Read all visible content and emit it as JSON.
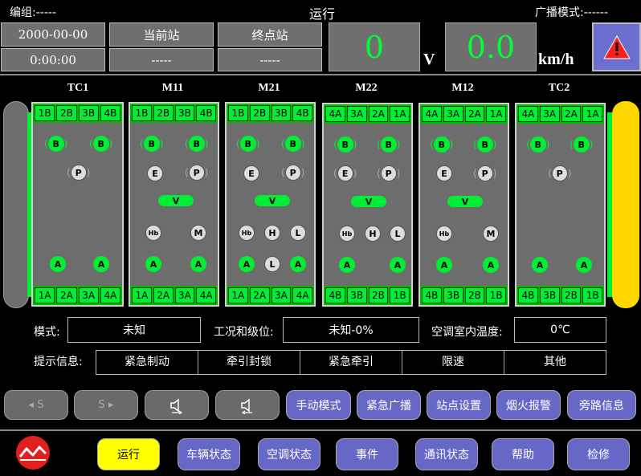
{
  "header": {
    "group_label": "编组:-----",
    "title": "运行",
    "broadcast_label": "广播模式:------"
  },
  "status": {
    "date": "2000-00-00",
    "time": "0:00:00",
    "current_station_label": "当前站",
    "current_station_value": "-----",
    "terminal_station_label": "终点站",
    "terminal_station_value": "-----",
    "voltage": "0",
    "voltage_unit": "V",
    "speed": "0.0",
    "speed_unit": "km/h"
  },
  "cars": [
    {
      "name": "TC1",
      "top": [
        "1B",
        "2B",
        "3B",
        "4B"
      ],
      "bottom": [
        "1A",
        "2A",
        "3A",
        "4A"
      ]
    },
    {
      "name": "M11",
      "top": [
        "1B",
        "2B",
        "3B",
        "4B"
      ],
      "bottom": [
        "1A",
        "2A",
        "3A",
        "4A"
      ]
    },
    {
      "name": "M21",
      "top": [
        "1B",
        "2B",
        "3B",
        "4B"
      ],
      "bottom": [
        "1A",
        "2A",
        "3A",
        "4A"
      ]
    },
    {
      "name": "M22",
      "top": [
        "4A",
        "3A",
        "2A",
        "1A"
      ],
      "bottom": [
        "4B",
        "3B",
        "2B",
        "1B"
      ]
    },
    {
      "name": "M12",
      "top": [
        "4A",
        "3A",
        "2A",
        "1A"
      ],
      "bottom": [
        "4B",
        "3B",
        "2B",
        "1B"
      ]
    },
    {
      "name": "TC2",
      "top": [
        "4A",
        "3A",
        "2A",
        "1A"
      ],
      "bottom": [
        "4B",
        "3B",
        "2B",
        "1B"
      ]
    }
  ],
  "indicators": {
    "B": "B",
    "P": "P",
    "E": "E",
    "V": "V",
    "Hb": "Hb",
    "H": "H",
    "L": "L",
    "M": "M",
    "A": "A"
  },
  "info": {
    "mode_label": "模式:",
    "mode_value": "未知",
    "condition_label": "工况和级位:",
    "condition_value": "未知-0%",
    "temp_label": "空调室内温度:",
    "temp_value": "0℃",
    "hint_label": "提示信息:",
    "hints": [
      "紧急制动",
      "牵引封锁",
      "紧急牵引",
      "限速",
      "其他"
    ]
  },
  "function_buttons": {
    "prev_station": "◂ S",
    "next_station": "S ▸",
    "manual_mode": "手动模式",
    "emergency_broadcast": "紧急广播",
    "station_setting": "站点设置",
    "fire_alarm": "烟火报警",
    "bypass_info": "旁路信息"
  },
  "nav": [
    "运行",
    "车辆状态",
    "空调状态",
    "事件",
    "通讯状态",
    "帮助",
    "检修"
  ],
  "colors": {
    "door_green": "#00ee33",
    "bumper_yellow": "#ffd700",
    "button_purple": "#6767c8",
    "active_yellow": "#ffff00"
  }
}
